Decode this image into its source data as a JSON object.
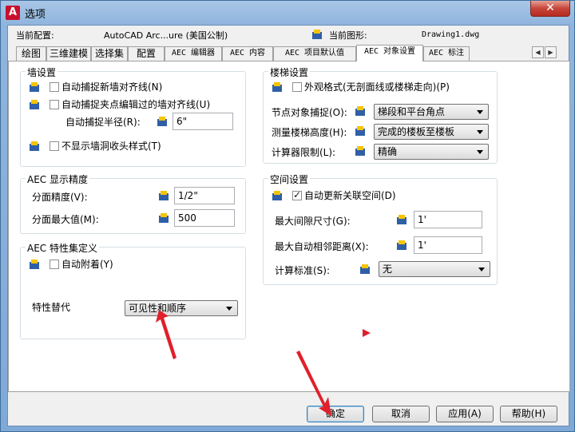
{
  "window": {
    "title": "选项",
    "close_label": "✕"
  },
  "config": {
    "current_profile_label": "当前配置:",
    "current_profile_value": "AutoCAD Arc...ure (美国公制)",
    "current_drawing_label": "当前图形:",
    "current_drawing_value": "Drawing1.dwg"
  },
  "tabs": [
    "绘图",
    "三维建模",
    "选择集",
    "配置",
    "AEC 编辑器",
    "AEC 内容",
    "AEC 项目默认值",
    "AEC 对象设置",
    "AEC 标注"
  ],
  "wall": {
    "title": "墙设置",
    "autosnap_new": "自动捕捉新墙对齐线(N)",
    "autosnap_grip": "自动捕捉夹点编辑过的墙对齐线(U)",
    "radius_label": "自动捕捉半径(R):",
    "radius_value": "6\"",
    "hide_cleanup": "不显示墙洞收头样式(T)"
  },
  "display": {
    "title": "AEC 显示精度",
    "facet_dev_label": "分面精度(V):",
    "facet_dev_value": "1/2\"",
    "facet_max_label": "分面最大值(M):",
    "facet_max_value": "500"
  },
  "propset": {
    "title": "AEC 特性集定义",
    "auto_attach": "自动附着(Y)",
    "override_label": "特性替代",
    "override_value": "可见性和顺序"
  },
  "stair": {
    "title": "楼梯设置",
    "plan_style": "外观格式(无剖面线或楼梯走向)(P)",
    "node_snap_label": "节点对象捕捉(O):",
    "node_snap_value": "梯段和平台角点",
    "measure_label": "测量楼梯高度(H):",
    "measure_value": "完成的楼板至楼板",
    "calc_label": "计算器限制(L):",
    "calc_value": "精确"
  },
  "space": {
    "title": "空间设置",
    "auto_update": "自动更新关联空间(D)",
    "max_gap_label": "最大间隙尺寸(G):",
    "max_gap_value": "1'",
    "max_adj_label": "最大自动相邻距离(X):",
    "max_adj_value": "1'",
    "calc_std_label": "计算标准(S):",
    "calc_std_value": "无"
  },
  "buttons": {
    "ok": "确定",
    "cancel": "取消",
    "apply": "应用(A)",
    "help": "帮助(H)"
  },
  "colors": {
    "annotation_arrow": "#e0202a"
  }
}
